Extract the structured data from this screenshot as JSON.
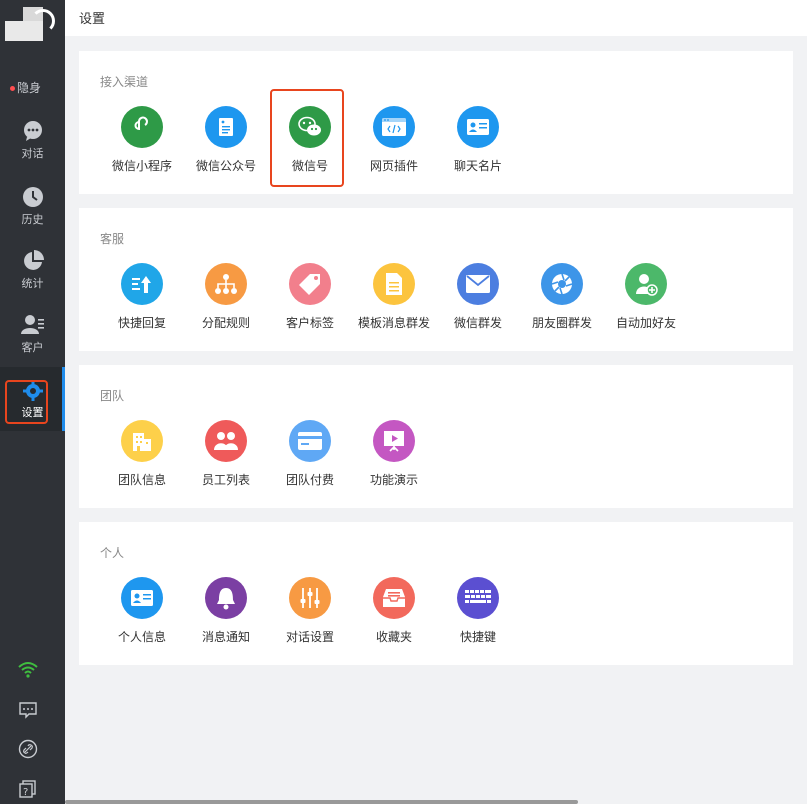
{
  "header": {
    "title": "设置"
  },
  "sidebar": {
    "status": "隐身",
    "items": [
      {
        "label": "对话",
        "icon": "chat-bubble-icon"
      },
      {
        "label": "历史",
        "icon": "clock-icon"
      },
      {
        "label": "统计",
        "icon": "pie-chart-icon"
      },
      {
        "label": "客户",
        "icon": "customer-icon"
      },
      {
        "label": "设置",
        "icon": "gear-icon"
      }
    ],
    "bottom_icons": [
      "wifi-icon",
      "message-icon",
      "link-icon",
      "help-icon"
    ]
  },
  "sections": [
    {
      "title": "接入渠道",
      "items": [
        {
          "label": "微信小程序",
          "icon": "mini-program-icon",
          "color": "#2e9a47"
        },
        {
          "label": "微信公众号",
          "icon": "official-account-icon",
          "color": "#1e97ef"
        },
        {
          "label": "微信号",
          "icon": "wechat-icon",
          "color": "#2e9a47"
        },
        {
          "label": "网页插件",
          "icon": "web-plugin-icon",
          "color": "#1e97ef"
        },
        {
          "label": "聊天名片",
          "icon": "business-card-icon",
          "color": "#1e97ef"
        }
      ]
    },
    {
      "title": "客服",
      "items": [
        {
          "label": "快捷回复",
          "icon": "quick-reply-icon",
          "color": "#20a6e8"
        },
        {
          "label": "分配规则",
          "icon": "org-chart-icon",
          "color": "#f79a43"
        },
        {
          "label": "客户标签",
          "icon": "tag-icon",
          "color": "#f27f8c"
        },
        {
          "label": "模板消息群发",
          "icon": "document-icon",
          "color": "#fcc43e"
        },
        {
          "label": "微信群发",
          "icon": "mail-icon",
          "color": "#4c7ee0"
        },
        {
          "label": "朋友圈群发",
          "icon": "aperture-icon",
          "color": "#3d95e8"
        },
        {
          "label": "自动加好友",
          "icon": "add-friend-icon",
          "color": "#4cb86a"
        }
      ]
    },
    {
      "title": "团队",
      "items": [
        {
          "label": "团队信息",
          "icon": "building-icon",
          "color": "#fdd04a"
        },
        {
          "label": "员工列表",
          "icon": "people-icon",
          "color": "#ef5a5a"
        },
        {
          "label": "团队付费",
          "icon": "credit-card-icon",
          "color": "#5fa8f5"
        },
        {
          "label": "功能演示",
          "icon": "presentation-icon",
          "color": "#c457c2"
        }
      ]
    },
    {
      "title": "个人",
      "items": [
        {
          "label": "个人信息",
          "icon": "id-card-icon",
          "color": "#1e97ef"
        },
        {
          "label": "消息通知",
          "icon": "bell-icon",
          "color": "#7b3fa3"
        },
        {
          "label": "对话设置",
          "icon": "sliders-icon",
          "color": "#f79a43"
        },
        {
          "label": "收藏夹",
          "icon": "inbox-icon",
          "color": "#f2695c"
        },
        {
          "label": "快捷键",
          "icon": "keyboard-icon",
          "color": "#5b4fd1"
        }
      ]
    }
  ]
}
